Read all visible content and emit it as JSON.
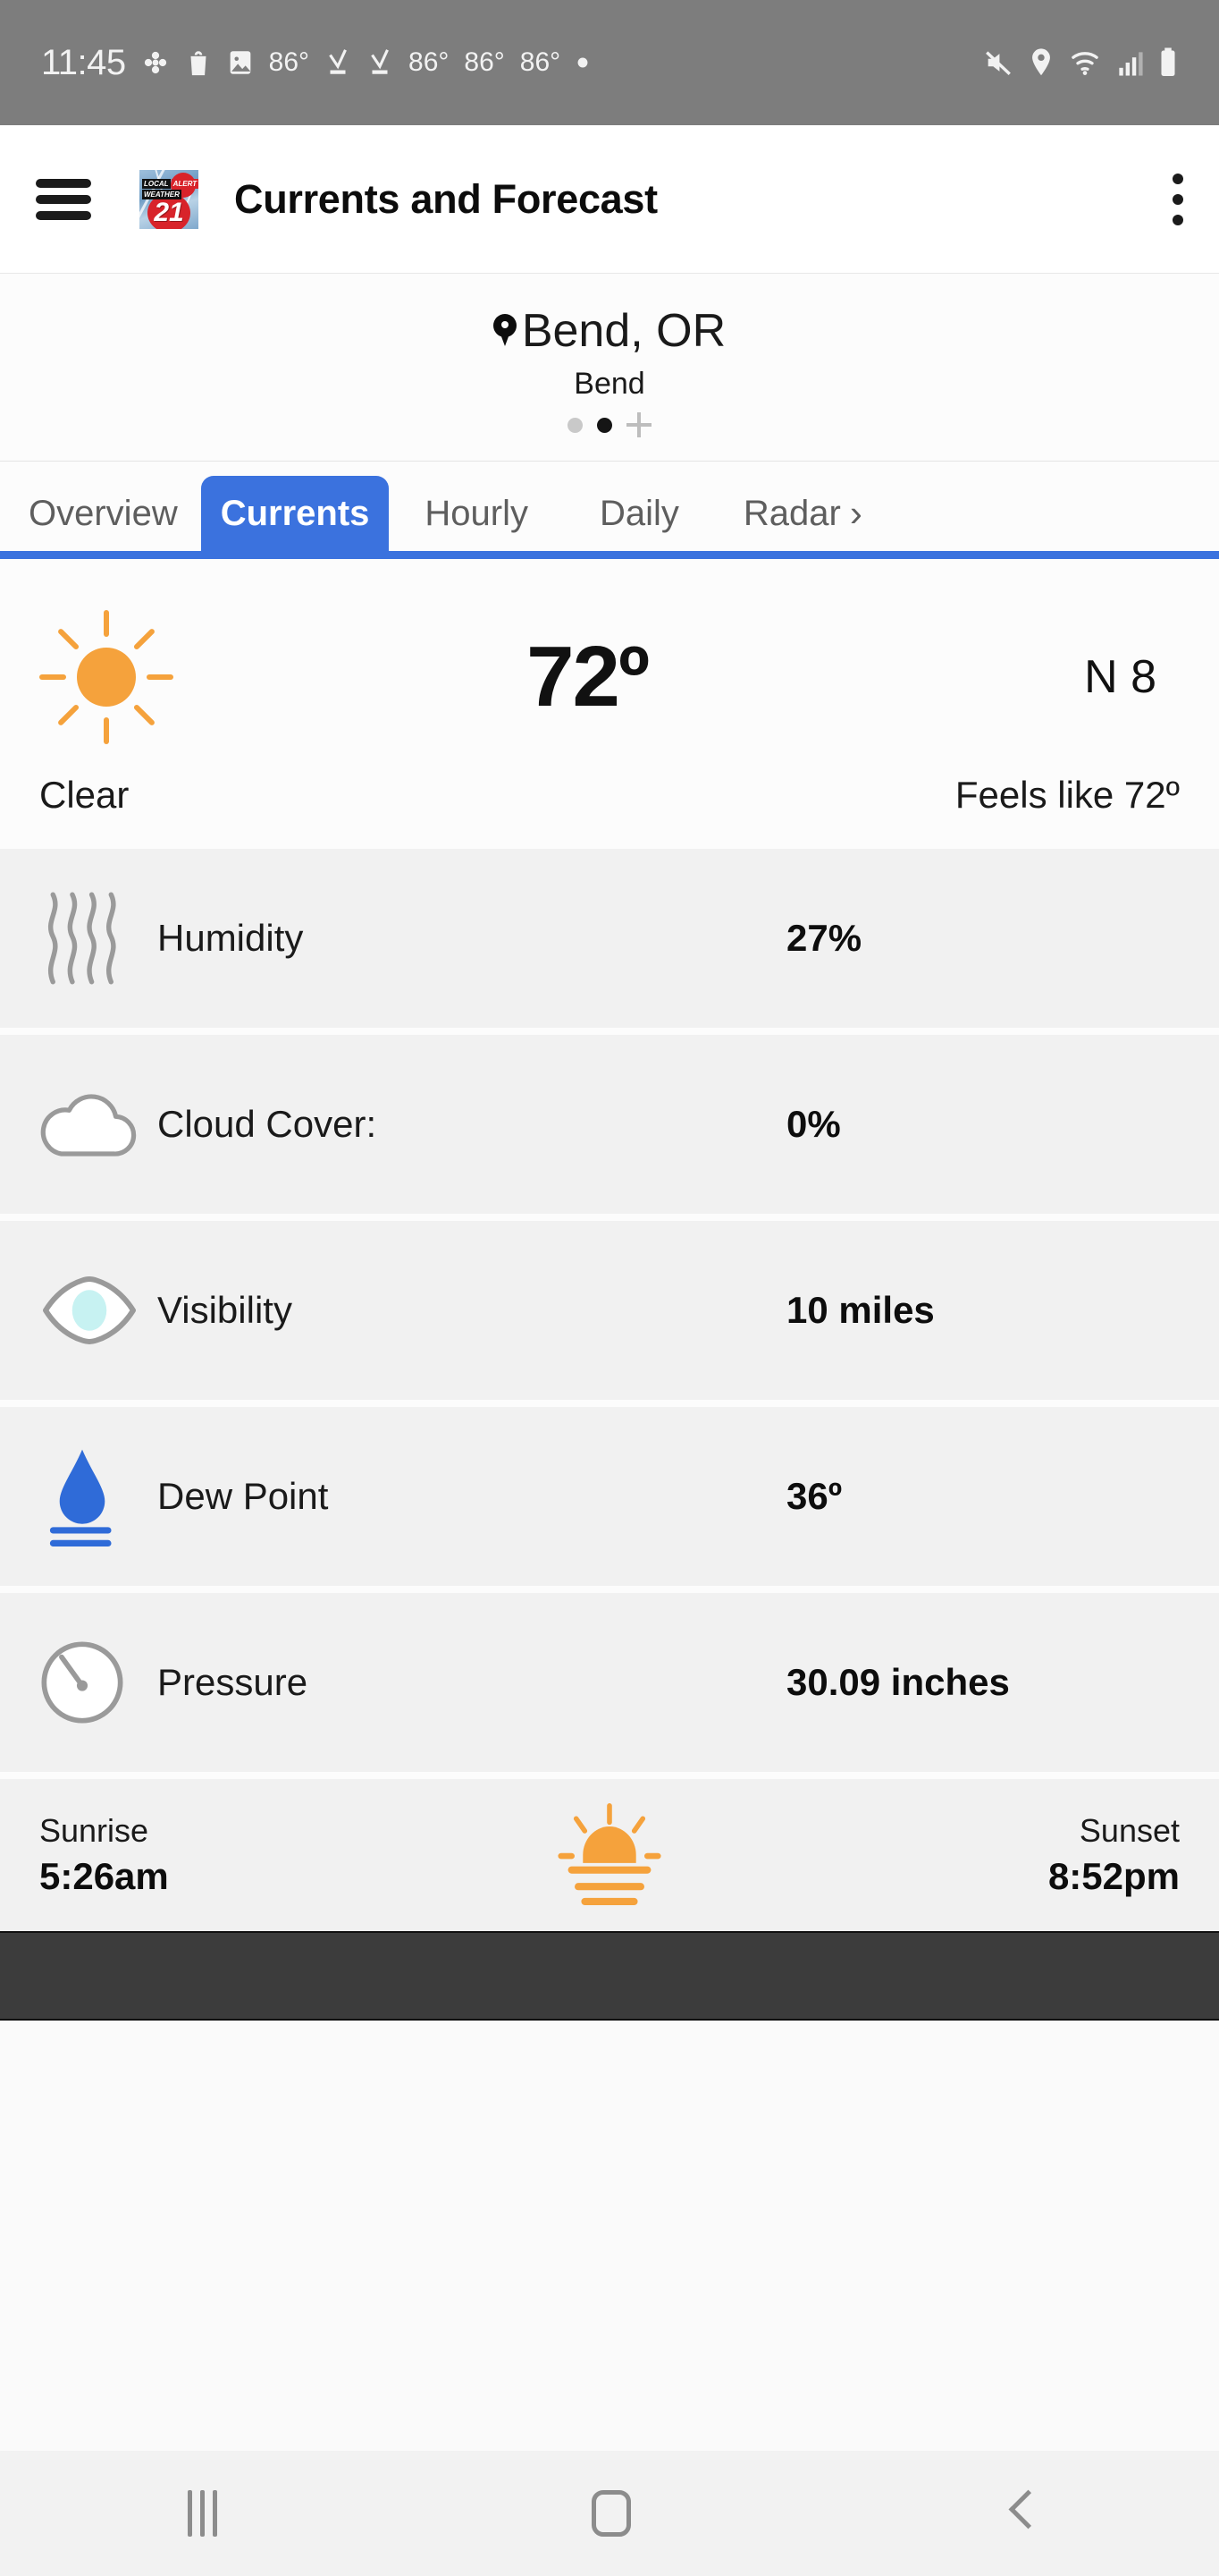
{
  "status_bar": {
    "time": "11:45",
    "temps": [
      "86°",
      "86°",
      "86°",
      "86°"
    ],
    "icons": [
      "clover-icon",
      "shopping-bag-icon",
      "image-icon",
      "download-complete-icon",
      "download-complete-icon",
      "dot-icon",
      "mute-icon",
      "location-icon",
      "wifi-icon",
      "cellular-signal-icon",
      "battery-icon"
    ]
  },
  "app_bar": {
    "menu_icon": "hamburger-menu-icon",
    "logo": {
      "line1_a": "LOCAL",
      "line1_b": "ALERT",
      "line2": "WEATHER",
      "channel": "21"
    },
    "title": "Currents and Forecast",
    "overflow_icon": "kebab-menu-icon"
  },
  "location": {
    "pin_icon": "location-pin-icon",
    "name": "Bend, OR",
    "sublabel": "Bend",
    "pager": {
      "count": 2,
      "active_index": 1
    },
    "add_icon": "plus-icon"
  },
  "tabs": {
    "items": [
      {
        "label": "Overview",
        "active": false
      },
      {
        "label": "Currents",
        "active": true
      },
      {
        "label": "Hourly",
        "active": false
      },
      {
        "label": "Daily",
        "active": false
      },
      {
        "label": "Radar",
        "active": false
      }
    ],
    "chevron": "›",
    "active_color": "#3B72DE"
  },
  "current": {
    "condition_icon": "sun-icon",
    "temperature": "72º",
    "wind": "N 8",
    "condition": "Clear",
    "feels_like": "Feels like 72º"
  },
  "details": [
    {
      "icon": "humidity-waves-icon",
      "label": "Humidity",
      "value": "27%"
    },
    {
      "icon": "cloud-icon",
      "label": "Cloud Cover:",
      "value": "0%"
    },
    {
      "icon": "eye-icon",
      "label": "Visibility",
      "value": "10 miles"
    },
    {
      "icon": "water-drop-icon",
      "label": "Dew Point",
      "value": "36º"
    },
    {
      "icon": "gauge-icon",
      "label": "Pressure",
      "value": "30.09 inches"
    }
  ],
  "sun_times": {
    "sunrise_label": "Sunrise",
    "sunrise_value": "5:26am",
    "sunset_label": "Sunset",
    "sunset_value": "8:52pm",
    "icon": "sunrise-horizon-icon"
  },
  "ad_banner": {
    "present": true,
    "content": ""
  },
  "nav_bar": {
    "recents_icon": "recent-apps-icon",
    "home_icon": "home-icon",
    "back_icon": "back-icon"
  },
  "colors": {
    "accent_blue": "#3B72DE",
    "sun_orange": "#F5A23C",
    "drop_blue": "#2F6BD8",
    "row_bg": "#F1F1F1",
    "status_bar_bg": "#7D7D7D",
    "ad_bg": "#3C3C3C"
  }
}
